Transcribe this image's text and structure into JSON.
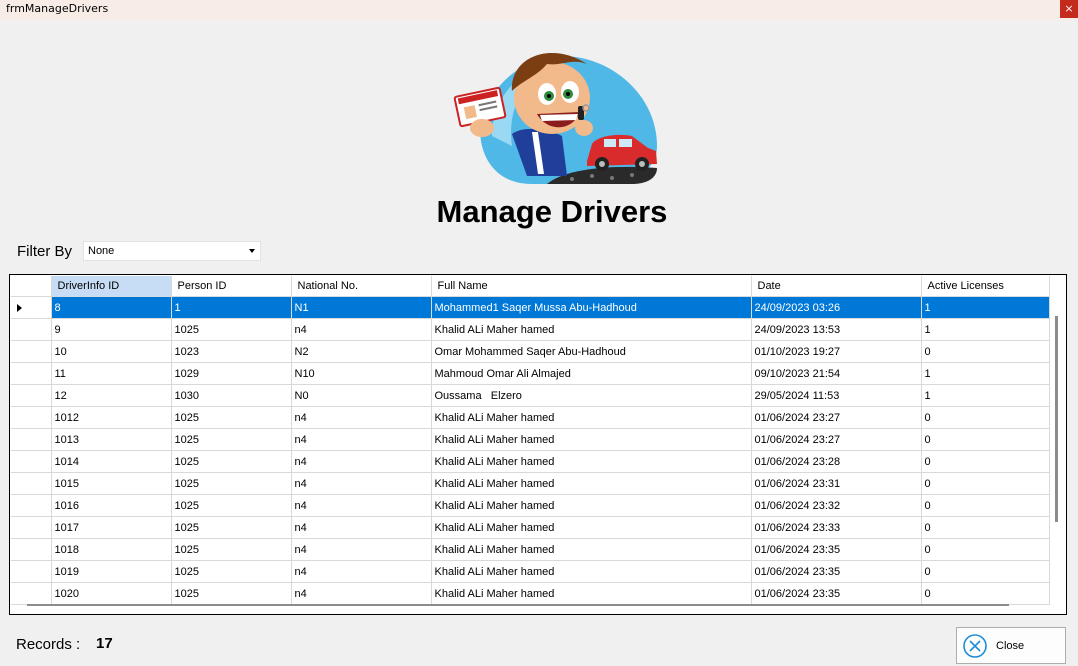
{
  "window": {
    "title": "frmManageDrivers",
    "close_glyph": "×"
  },
  "header": {
    "title": "Manage Drivers"
  },
  "filter": {
    "label": "Filter By",
    "selected": "None"
  },
  "grid": {
    "columns": [
      "DriverInfo ID",
      "Person ID",
      "National No.",
      "Full Name",
      "Date",
      "Active Licenses"
    ],
    "rows": [
      [
        "8",
        "1",
        "N1",
        "Mohammed1 Saqer Mussa Abu-Hadhoud",
        "24/09/2023 03:26",
        "1"
      ],
      [
        "9",
        "1025",
        "n4",
        "Khalid ALi Maher hamed",
        "24/09/2023 13:53",
        "1"
      ],
      [
        "10",
        "1023",
        "N2",
        "Omar Mohammed Saqer Abu-Hadhoud",
        "01/10/2023 19:27",
        "0"
      ],
      [
        "11",
        "1029",
        "N10",
        "Mahmoud Omar Ali Almajed",
        "09/10/2023 21:54",
        "1"
      ],
      [
        "12",
        "1030",
        "N0",
        "Oussama   Elzero",
        "29/05/2024 11:53",
        "1"
      ],
      [
        "1012",
        "1025",
        "n4",
        "Khalid ALi Maher hamed",
        "01/06/2024 23:27",
        "0"
      ],
      [
        "1013",
        "1025",
        "n4",
        "Khalid ALi Maher hamed",
        "01/06/2024 23:27",
        "0"
      ],
      [
        "1014",
        "1025",
        "n4",
        "Khalid ALi Maher hamed",
        "01/06/2024 23:28",
        "0"
      ],
      [
        "1015",
        "1025",
        "n4",
        "Khalid ALi Maher hamed",
        "01/06/2024 23:31",
        "0"
      ],
      [
        "1016",
        "1025",
        "n4",
        "Khalid ALi Maher hamed",
        "01/06/2024 23:32",
        "0"
      ],
      [
        "1017",
        "1025",
        "n4",
        "Khalid ALi Maher hamed",
        "01/06/2024 23:33",
        "0"
      ],
      [
        "1018",
        "1025",
        "n4",
        "Khalid ALi Maher hamed",
        "01/06/2024 23:35",
        "0"
      ],
      [
        "1019",
        "1025",
        "n4",
        "Khalid ALi Maher hamed",
        "01/06/2024 23:35",
        "0"
      ],
      [
        "1020",
        "1025",
        "n4",
        "Khalid ALi Maher hamed",
        "01/06/2024 23:35",
        "0"
      ]
    ]
  },
  "footer": {
    "records_label": "Records :",
    "records_count": "17",
    "close_label": "Close"
  },
  "colors": {
    "selection": "#0078d7",
    "header_active": "#c6ddf5",
    "close_icon": "#1e8fd6"
  }
}
